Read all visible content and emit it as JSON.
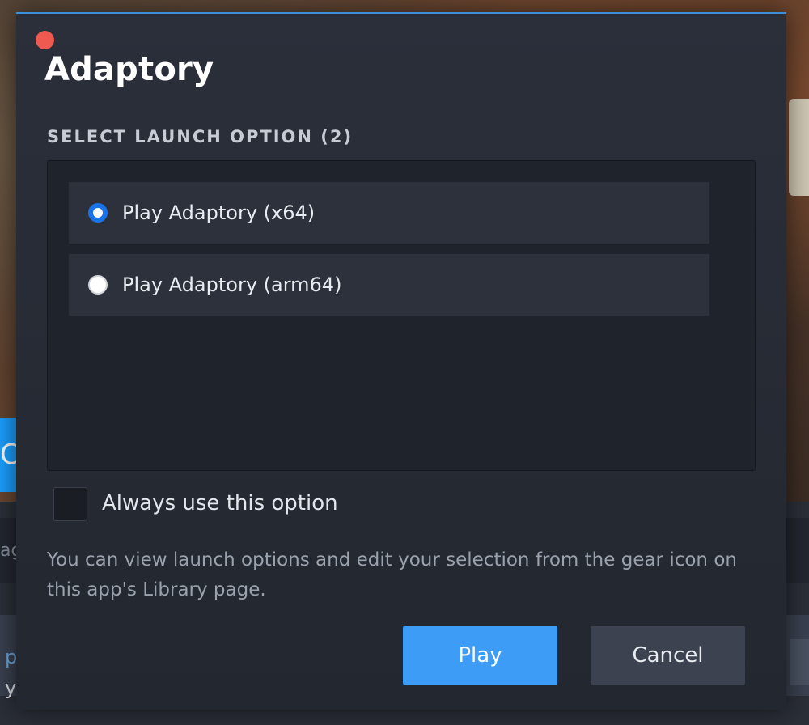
{
  "dialog": {
    "title": "Adaptory",
    "section_label": "SELECT LAUNCH OPTION (2)",
    "options": [
      {
        "label": "Play Adaptory (x64)",
        "selected": true
      },
      {
        "label": "Play Adaptory (arm64)",
        "selected": false
      }
    ],
    "always_use_label": "Always use this option",
    "always_use_checked": false,
    "help_text": "You can view launch options and edit your selection from the gear icon on this app's Library page.",
    "play_label": "Play",
    "cancel_label": "Cancel"
  },
  "background": {
    "partial_texts": [
      "CA",
      "ag",
      "p",
      "y"
    ]
  },
  "colors": {
    "accent_blue": "#3d9cf6",
    "radio_selected": "#1a73e8",
    "close_red": "#ee5a4f",
    "dialog_bg": "#23272f"
  }
}
